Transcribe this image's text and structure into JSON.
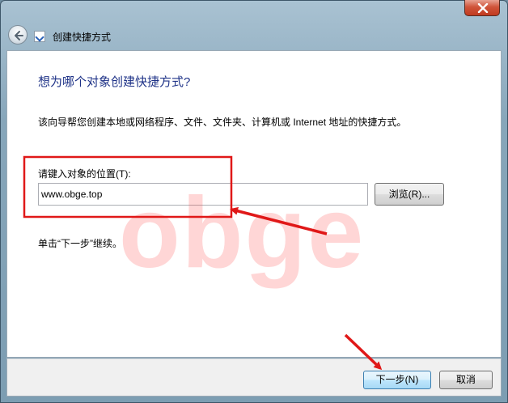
{
  "window": {
    "title": "创建快捷方式",
    "close_label": "×"
  },
  "page": {
    "heading": "想为哪个对象创建快捷方式?",
    "description": "该向导帮您创建本地或网络程序、文件、文件夹、计算机或 Internet 地址的快捷方式。",
    "location_label": "请键入对象的位置(T):",
    "location_value": "www.obge.top",
    "browse_label": "浏览(R)...",
    "hint": "单击“下一步”继续。"
  },
  "footer": {
    "next_label": "下一步(N)",
    "cancel_label": "取消"
  },
  "watermark": "obge",
  "colors": {
    "heading": "#1e3287",
    "annotation_red": "#e01818",
    "watermark": "#ff4646"
  },
  "icons": [
    "back-arrow-icon",
    "shortcut-wizard-icon",
    "close-icon"
  ]
}
